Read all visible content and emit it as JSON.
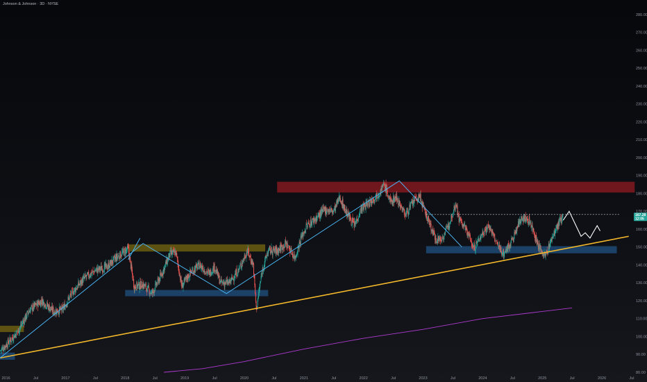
{
  "header": {
    "title": "Johnson & Johnson · 3D · NYSE"
  },
  "colors": {
    "up": "#26a69a",
    "down": "#ef5350",
    "trendline": "#f5b82a",
    "pattern_path": "#4ab3f0",
    "projection": "#ffffff",
    "moving_average": "#b03ad3",
    "resistance_zone": "#8a1a22",
    "support_zone": "#1e4d7a",
    "yellow_zone": "#6b5d12",
    "price_badge": "#26a69a"
  },
  "chart_data": {
    "type": "candlestick",
    "title": "Johnson & Johnson · 3D · NYSE",
    "xlabel": "",
    "ylabel": "",
    "x_range": [
      2015.9,
      2026.5
    ],
    "ylim": [
      80,
      285
    ],
    "y_ticks": [
      "80.00",
      "90.00",
      "100.00",
      "110.00",
      "120.00",
      "130.00",
      "140.00",
      "150.00",
      "160.00",
      "170.00",
      "180.00",
      "190.00",
      "200.00",
      "210.00",
      "220.00",
      "230.00",
      "240.00",
      "250.00",
      "260.00",
      "270.00",
      "280.00"
    ],
    "y_tick_values": [
      80,
      90,
      100,
      110,
      120,
      130,
      140,
      150,
      160,
      170,
      180,
      190,
      200,
      210,
      220,
      230,
      240,
      250,
      260,
      270,
      280
    ],
    "x_ticks": [
      {
        "label": "2016",
        "t": 2016.0
      },
      {
        "label": "Jul",
        "t": 2016.5
      },
      {
        "label": "2017",
        "t": 2017.0
      },
      {
        "label": "Jul",
        "t": 2017.5
      },
      {
        "label": "2018",
        "t": 2018.0
      },
      {
        "label": "Jul",
        "t": 2018.5
      },
      {
        "label": "2019",
        "t": 2019.0
      },
      {
        "label": "Jul",
        "t": 2019.5
      },
      {
        "label": "2020",
        "t": 2020.0
      },
      {
        "label": "Jul",
        "t": 2020.5
      },
      {
        "label": "2021",
        "t": 2021.0
      },
      {
        "label": "Jul",
        "t": 2021.5
      },
      {
        "label": "2022",
        "t": 2022.0
      },
      {
        "label": "Jul",
        "t": 2022.5
      },
      {
        "label": "2023",
        "t": 2023.0
      },
      {
        "label": "Jul",
        "t": 2023.5
      },
      {
        "label": "2024",
        "t": 2024.0
      },
      {
        "label": "Jul",
        "t": 2024.5
      },
      {
        "label": "2025",
        "t": 2025.0
      },
      {
        "label": "Jul",
        "t": 2025.5
      },
      {
        "label": "2026",
        "t": 2026.0
      },
      {
        "label": "Jul",
        "t": 2026.5
      }
    ],
    "price_path": [
      [
        2015.9,
        92
      ],
      [
        2016.05,
        97
      ],
      [
        2016.2,
        103
      ],
      [
        2016.4,
        115
      ],
      [
        2016.6,
        120
      ],
      [
        2016.8,
        114
      ],
      [
        2016.95,
        115
      ],
      [
        2017.1,
        124
      ],
      [
        2017.3,
        132
      ],
      [
        2017.5,
        137
      ],
      [
        2017.7,
        139
      ],
      [
        2017.85,
        144
      ],
      [
        2018.05,
        149
      ],
      [
        2018.15,
        128
      ],
      [
        2018.3,
        129
      ],
      [
        2018.45,
        124
      ],
      [
        2018.6,
        134
      ],
      [
        2018.75,
        146
      ],
      [
        2018.85,
        147
      ],
      [
        2018.95,
        128
      ],
      [
        2019.1,
        136
      ],
      [
        2019.25,
        140
      ],
      [
        2019.4,
        135
      ],
      [
        2019.5,
        139
      ],
      [
        2019.6,
        130
      ],
      [
        2019.75,
        130
      ],
      [
        2019.9,
        137
      ],
      [
        2020.05,
        148
      ],
      [
        2020.15,
        140
      ],
      [
        2020.2,
        115
      ],
      [
        2020.3,
        137
      ],
      [
        2020.4,
        148
      ],
      [
        2020.55,
        148
      ],
      [
        2020.7,
        152
      ],
      [
        2020.85,
        144
      ],
      [
        2020.95,
        155
      ],
      [
        2021.05,
        162
      ],
      [
        2021.2,
        166
      ],
      [
        2021.35,
        171
      ],
      [
        2021.5,
        170
      ],
      [
        2021.6,
        178
      ],
      [
        2021.7,
        170
      ],
      [
        2021.85,
        162
      ],
      [
        2021.95,
        171
      ],
      [
        2022.1,
        175
      ],
      [
        2022.25,
        180
      ],
      [
        2022.35,
        185
      ],
      [
        2022.45,
        175
      ],
      [
        2022.55,
        178
      ],
      [
        2022.7,
        168
      ],
      [
        2022.85,
        176
      ],
      [
        2022.95,
        178
      ],
      [
        2023.0,
        172
      ],
      [
        2023.1,
        164
      ],
      [
        2023.2,
        155
      ],
      [
        2023.3,
        154
      ],
      [
        2023.4,
        160
      ],
      [
        2023.55,
        175
      ],
      [
        2023.6,
        166
      ],
      [
        2023.75,
        158
      ],
      [
        2023.85,
        149
      ],
      [
        2024.0,
        158
      ],
      [
        2024.1,
        162
      ],
      [
        2024.25,
        151
      ],
      [
        2024.35,
        146
      ],
      [
        2024.5,
        154
      ],
      [
        2024.65,
        167
      ],
      [
        2024.8,
        164
      ],
      [
        2024.95,
        149
      ],
      [
        2025.05,
        145
      ],
      [
        2025.2,
        158
      ],
      [
        2025.35,
        167.28
      ]
    ],
    "overlays": {
      "ascending_trendline": {
        "from": [
          2015.9,
          88.0
        ],
        "to": [
          2026.45,
          156.0
        ]
      },
      "pattern_lines": [
        [
          [
            2015.9,
            88.0
          ],
          [
            2018.3,
            152.0
          ],
          [
            2019.7,
            124.0
          ],
          [
            2022.6,
            187.0
          ],
          [
            2023.65,
            150.0
          ]
        ]
      ],
      "pattern_arrow": {
        "from": [
          2018.05,
          143.0
        ],
        "to": [
          2018.25,
          155.0
        ]
      },
      "zones": [
        {
          "kind": "resistance",
          "t0": 2020.55,
          "t1": 2026.55,
          "y0": 180.5,
          "y1": 186.5
        },
        {
          "kind": "support",
          "t0": 2023.05,
          "t1": 2026.25,
          "y0": 146.5,
          "y1": 150.5
        },
        {
          "kind": "support",
          "t0": 2018.0,
          "t1": 2020.4,
          "y0": 122.5,
          "y1": 126.0
        },
        {
          "kind": "yellow",
          "t0": 2018.05,
          "t1": 2020.35,
          "y0": 147.5,
          "y1": 151.5
        },
        {
          "kind": "yellow",
          "t0": 2015.9,
          "t1": 2016.3,
          "y0": 102.5,
          "y1": 106.0
        },
        {
          "kind": "support",
          "t0": 2015.9,
          "t1": 2016.15,
          "y0": 87.0,
          "y1": 91.0
        }
      ],
      "level_line": {
        "t0": 2023.05,
        "t1": 2026.3,
        "y": 168.2
      },
      "projection_path": [
        [
          2025.35,
          165
        ],
        [
          2025.45,
          170
        ],
        [
          2025.55,
          163
        ],
        [
          2025.65,
          156
        ],
        [
          2025.72,
          158
        ],
        [
          2025.8,
          155
        ],
        [
          2025.85,
          158
        ],
        [
          2025.92,
          162
        ],
        [
          2025.97,
          159
        ]
      ],
      "moving_average": [
        [
          2018.65,
          80
        ],
        [
          2019.3,
          82
        ],
        [
          2020.0,
          86
        ],
        [
          2021.0,
          93
        ],
        [
          2022.0,
          99
        ],
        [
          2023.0,
          104
        ],
        [
          2024.0,
          110
        ],
        [
          2025.0,
          114
        ],
        [
          2025.5,
          116
        ]
      ]
    },
    "last_price": {
      "value": "167.28",
      "sub": "12:05"
    },
    "grid": false,
    "legend": "none"
  }
}
